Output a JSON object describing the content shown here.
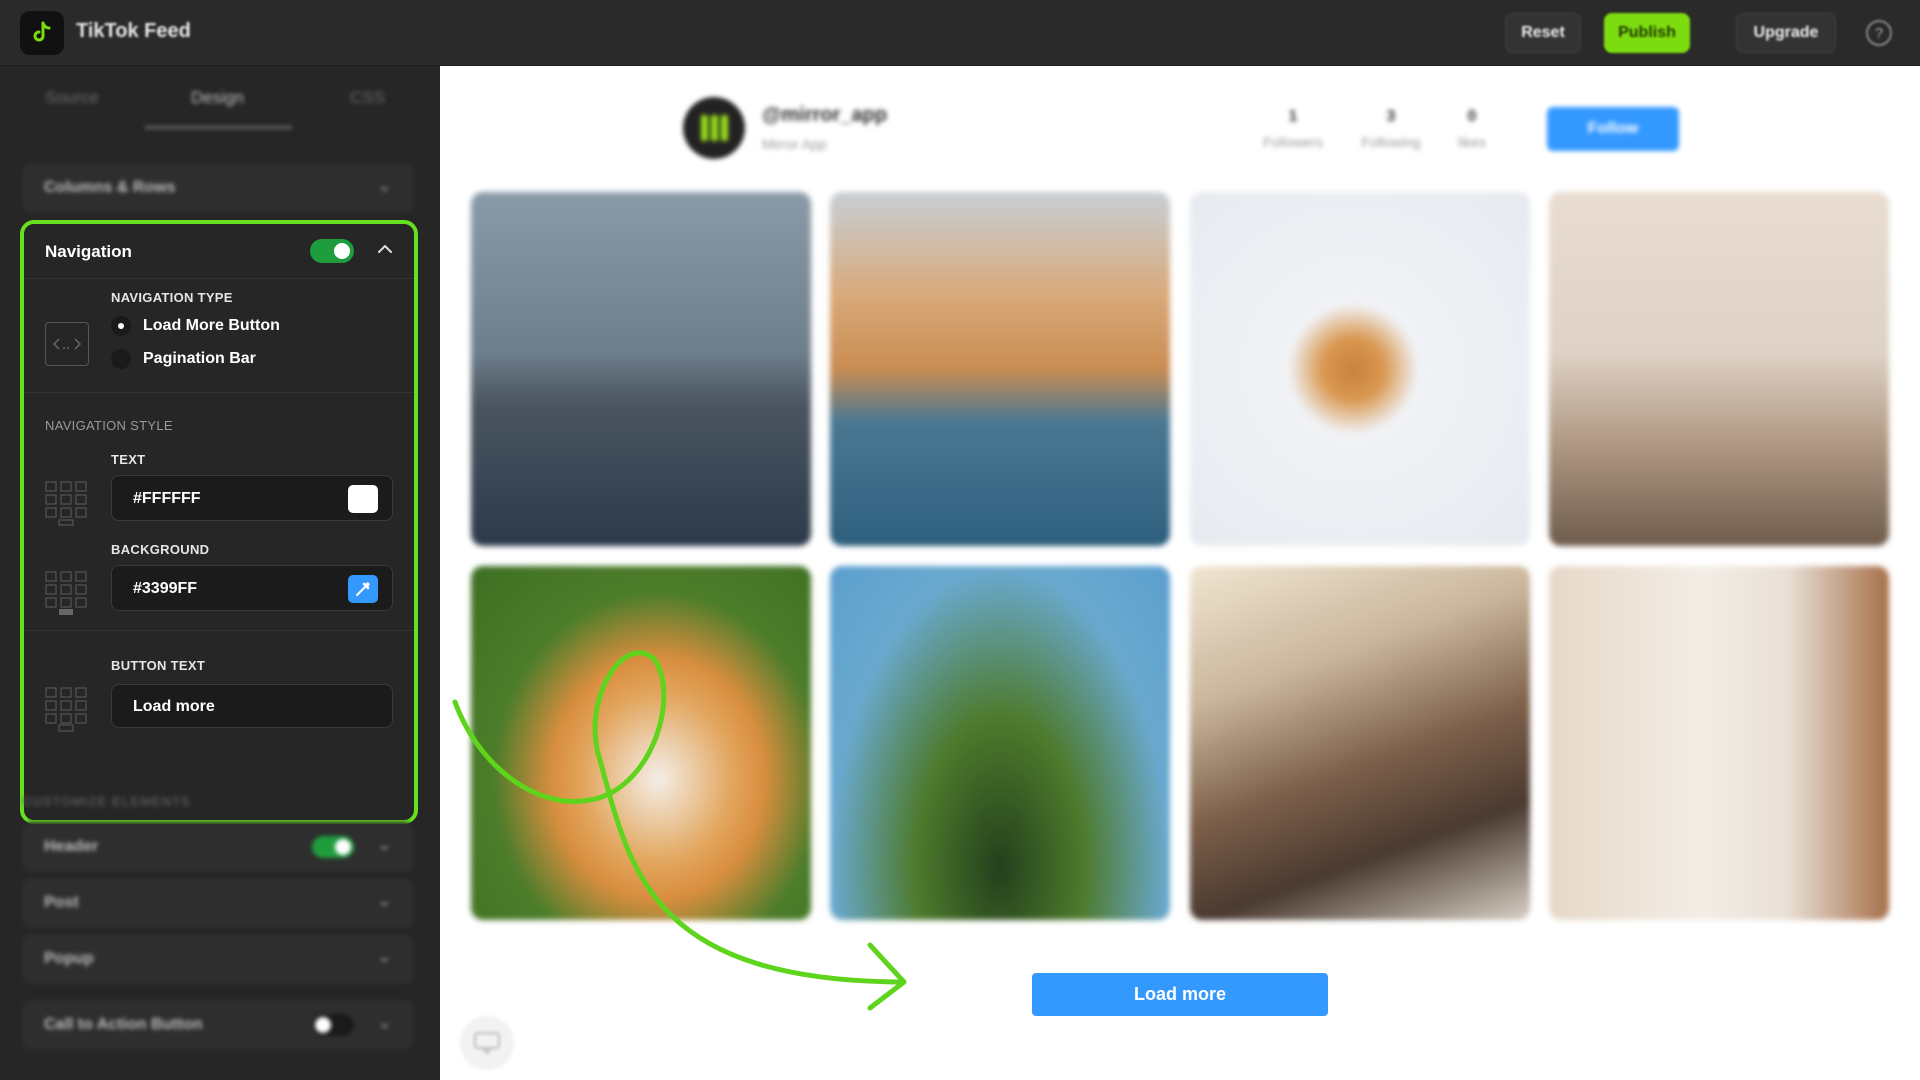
{
  "app": {
    "title": "TikTok Feed",
    "logo_icon": "tiktok-icon"
  },
  "toolbar": {
    "reset_label": "Reset",
    "publish_label": "Publish",
    "upgrade_label": "Upgrade",
    "help_icon": "question-icon",
    "help_glyph": "?"
  },
  "sidebar": {
    "tabs": [
      {
        "label": "Source",
        "active": false
      },
      {
        "label": "Design",
        "active": true
      },
      {
        "label": "CSS",
        "active": false
      }
    ],
    "columns_rows_label": "Columns & Rows",
    "navigation": {
      "title": "Navigation",
      "enabled": true,
      "type_caption": "NAVIGATION TYPE",
      "type_options": [
        {
          "label": "Load More Button",
          "selected": true
        },
        {
          "label": "Pagination Bar",
          "selected": false
        }
      ],
      "style_caption": "NAVIGATION STYLE",
      "text_caption": "TEXT",
      "text_color": "#FFFFFF",
      "background_caption": "BACKGROUND",
      "background_color": "#3399FF",
      "button_text_caption": "BUTTON TEXT",
      "button_text_value": "Load more"
    },
    "customize_caption": "CUSTOMIZE ELEMENTS",
    "elements": [
      {
        "label": "Header",
        "toggle": true
      },
      {
        "label": "Post",
        "toggle": null
      },
      {
        "label": "Popup",
        "toggle": null
      }
    ],
    "cta": {
      "label": "Call to Action Button",
      "toggle": false
    }
  },
  "preview": {
    "username": "@mirror_app",
    "display_name": "Mirror App",
    "stats": [
      {
        "value": "1",
        "label": "Followers"
      },
      {
        "value": "3",
        "label": "Following"
      },
      {
        "value": "0",
        "label": "likes"
      }
    ],
    "follow_label": "Follow",
    "load_more_label": "Load more"
  },
  "colors": {
    "accent": "#3399FF",
    "highlight": "#66E01F",
    "publish": "#7DDC0F",
    "toggle_on": "#1F9D3D"
  }
}
